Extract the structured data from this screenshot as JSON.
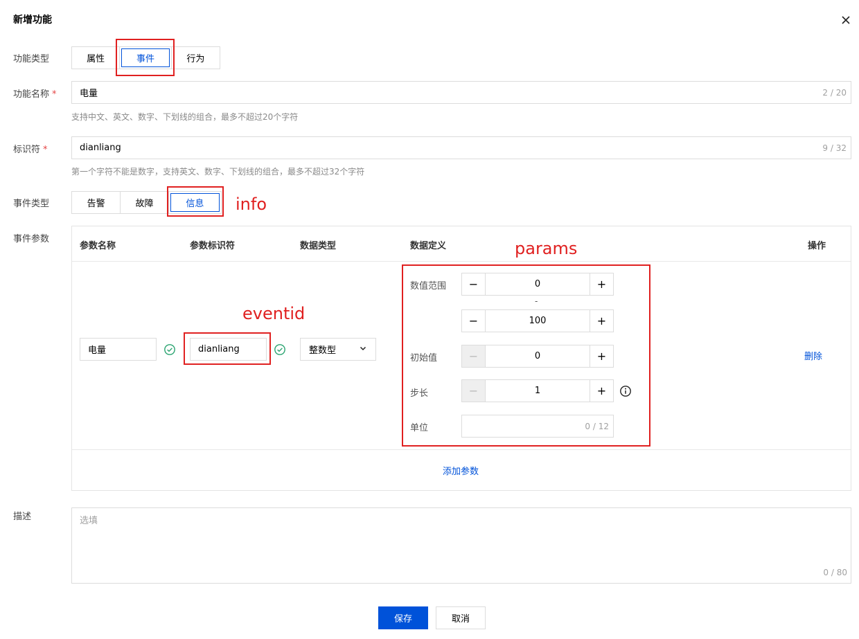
{
  "dialog": {
    "title": "新增功能",
    "close_icon": "close-icon"
  },
  "feature_type": {
    "label": "功能类型",
    "options": [
      "属性",
      "事件",
      "行为"
    ],
    "selected": "事件"
  },
  "feature_name": {
    "label": "功能名称",
    "required_mark": "*",
    "value": "电量",
    "counter": "2 / 20",
    "hint": "支持中文、英文、数字、下划线的组合，最多不超过20个字符"
  },
  "identifier": {
    "label": "标识符",
    "required_mark": "*",
    "value": "dianliang",
    "counter": "9 / 32",
    "hint": "第一个字符不能是数字，支持英文、数字、下划线的组合，最多不超过32个字符"
  },
  "event_type": {
    "label": "事件类型",
    "options": [
      "告警",
      "故障",
      "信息"
    ],
    "selected": "信息"
  },
  "event_params": {
    "label": "事件参数",
    "columns": [
      "参数名称",
      "参数标识符",
      "数据类型",
      "数据定义",
      "操作"
    ],
    "row": {
      "name": "电量",
      "identifier": "dianliang",
      "data_type": "整数型",
      "definition": {
        "range_label": "数值范围",
        "range_min": "0",
        "range_sep": "-",
        "range_max": "100",
        "initial_label": "初始值",
        "initial_value": "0",
        "step_label": "步长",
        "step_value": "1",
        "unit_label": "单位",
        "unit_counter": "0 / 12"
      },
      "action": "删除"
    },
    "add_param": "添加参数"
  },
  "description": {
    "label": "描述",
    "placeholder": "选填",
    "counter": "0 / 80"
  },
  "footer": {
    "save": "保存",
    "cancel": "取消"
  },
  "annotations": {
    "info": "info",
    "params": "params",
    "eventid": "eventid"
  },
  "colors": {
    "primary": "#0052d9",
    "annotation": "#e02020",
    "required": "#e54545",
    "success": "#2ba471"
  },
  "icons": {
    "close": "close-icon",
    "check": "check-circle-icon",
    "chevron": "chevron-down-icon",
    "info": "info-circle-icon"
  }
}
